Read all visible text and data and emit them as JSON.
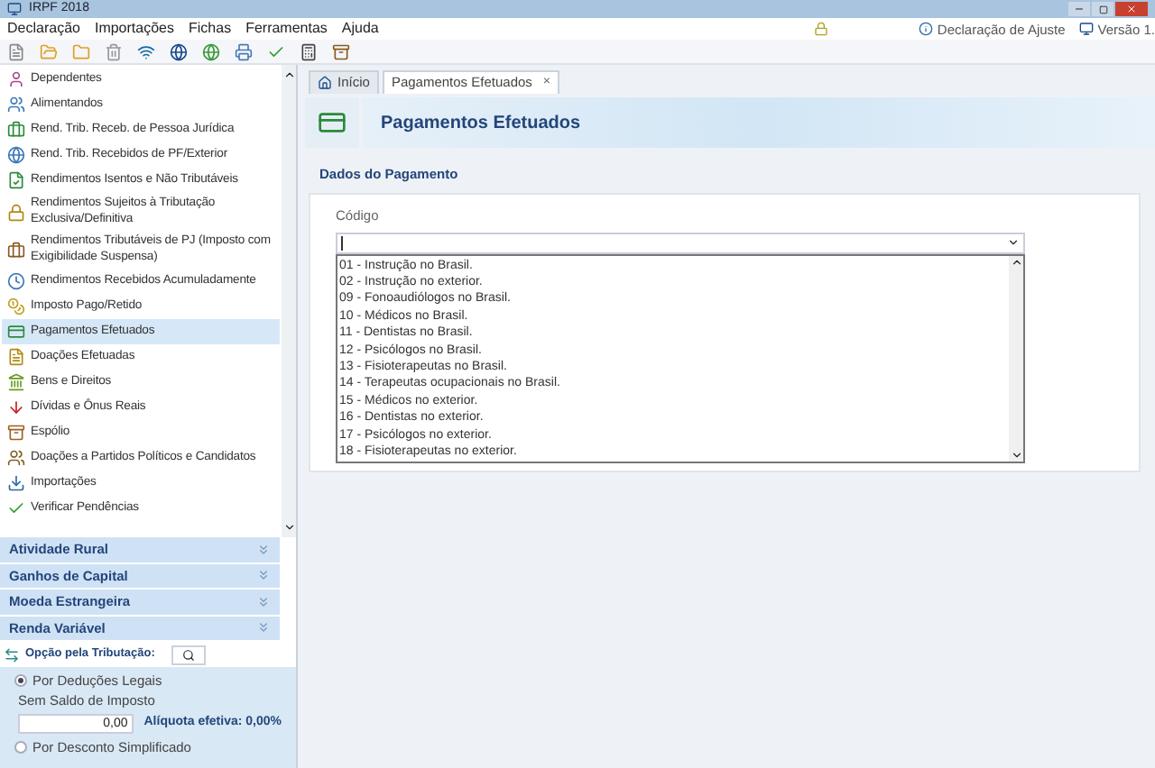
{
  "window": {
    "title": "IRPF 2018"
  },
  "menu": [
    "Declaração",
    "Importações",
    "Fichas",
    "Ferramentas",
    "Ajuda"
  ],
  "header_info": [
    {
      "label": "Declaração de Ajuste"
    },
    {
      "label": "Versão 1."
    }
  ],
  "sidebar": {
    "items": [
      {
        "label": "Dependentes",
        "selected": false
      },
      {
        "label": "Alimentandos",
        "selected": false
      },
      {
        "label": "Rend. Trib. Receb. de Pessoa Jurídica",
        "selected": false
      },
      {
        "label": "Rend. Trib. Recebidos de PF/Exterior",
        "selected": false
      },
      {
        "label": "Rendimentos Isentos e Não Tributáveis",
        "selected": false
      },
      {
        "label": "Rendimentos Sujeitos à Tributação Exclusiva/Definitiva",
        "selected": false
      },
      {
        "label": "Rendimentos Tributáveis de PJ (Imposto com Exigibilidade Suspensa)",
        "selected": false
      },
      {
        "label": "Rendimentos Recebidos Acumuladamente",
        "selected": false
      },
      {
        "label": "Imposto Pago/Retido",
        "selected": false
      },
      {
        "label": "Pagamentos Efetuados",
        "selected": true
      },
      {
        "label": "Doações Efetuadas",
        "selected": false
      },
      {
        "label": "Bens e Direitos",
        "selected": false
      },
      {
        "label": "Dívidas e Ônus Reais",
        "selected": false
      },
      {
        "label": "Espólio",
        "selected": false
      },
      {
        "label": "Doações a Partidos Políticos e Candidatos",
        "selected": false
      },
      {
        "label": "Importações",
        "selected": false
      },
      {
        "label": "Verificar Pendências",
        "selected": false
      }
    ],
    "sections": [
      {
        "label": "Atividade Rural",
        "expanded": false
      },
      {
        "label": "Ganhos de Capital",
        "expanded": false
      },
      {
        "label": "Moeda Estrangeira",
        "expanded": false
      },
      {
        "label": "Renda Variável",
        "expanded": false
      }
    ]
  },
  "tax_option": {
    "title": "Opção pela Tributação:",
    "options": [
      {
        "label": "Por Deduções Legais",
        "selected": true,
        "sublabel": "Sem Saldo de Imposto",
        "value": "0,00",
        "rate": "Alíquota efetiva: 0,00%"
      },
      {
        "label": "Por Desconto Simplificado",
        "selected": false
      }
    ]
  },
  "tabs": [
    {
      "label": "Início",
      "selected": false
    },
    {
      "label": "Pagamentos Efetuados",
      "selected": true,
      "close": "×"
    }
  ],
  "page_title": "Pagamentos Efetuados",
  "section_title": "Dados do Pagamento",
  "field": {
    "label": "Código"
  },
  "dropdown_options": [
    "01 - Instrução no Brasil.",
    "02 - Instrução no exterior.",
    "09 - Fonoaudiólogos no Brasil.",
    "10 - Médicos no Brasil.",
    "11 - Dentistas no Brasil.",
    "12 - Psicólogos no Brasil.",
    "13 - Fisioterapeutas no Brasil.",
    "14 - Terapeutas ocupacionais no Brasil.",
    "15 - Médicos no exterior.",
    "16 - Dentistas no exterior.",
    "17 - Psicólogos no exterior.",
    "18 - Fisioterapeutas no exterior."
  ]
}
